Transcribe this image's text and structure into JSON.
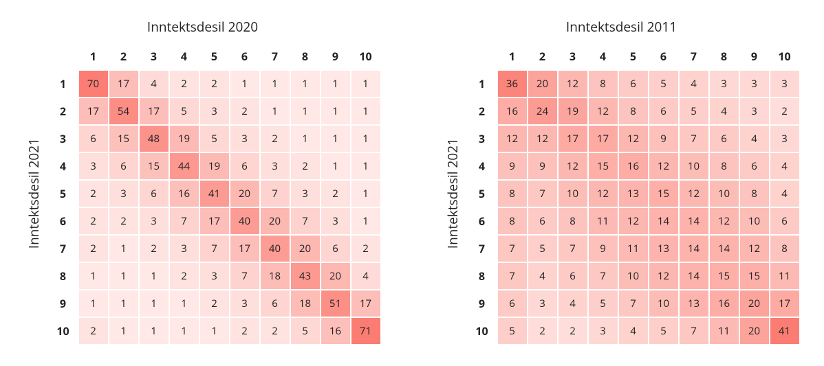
{
  "chart_data": [
    {
      "type": "heatmap",
      "title": "Inntektsdesil 2020",
      "ylabel": "Inntektsdesil 2021",
      "row_labels": [
        "1",
        "2",
        "3",
        "4",
        "5",
        "6",
        "7",
        "8",
        "9",
        "10"
      ],
      "col_labels": [
        "1",
        "2",
        "3",
        "4",
        "5",
        "6",
        "7",
        "8",
        "9",
        "10"
      ],
      "values": [
        [
          70,
          17,
          4,
          2,
          2,
          1,
          1,
          1,
          1,
          1
        ],
        [
          17,
          54,
          17,
          5,
          3,
          2,
          1,
          1,
          1,
          1
        ],
        [
          6,
          15,
          48,
          19,
          5,
          3,
          2,
          1,
          1,
          1
        ],
        [
          3,
          6,
          15,
          44,
          19,
          6,
          3,
          2,
          1,
          1
        ],
        [
          2,
          3,
          6,
          16,
          41,
          20,
          7,
          3,
          2,
          1
        ],
        [
          2,
          2,
          3,
          7,
          17,
          40,
          20,
          7,
          3,
          1
        ],
        [
          2,
          1,
          2,
          3,
          7,
          17,
          40,
          20,
          6,
          2
        ],
        [
          1,
          1,
          1,
          2,
          3,
          7,
          18,
          43,
          20,
          4
        ],
        [
          1,
          1,
          1,
          1,
          2,
          3,
          6,
          18,
          51,
          17
        ],
        [
          2,
          1,
          1,
          1,
          1,
          2,
          2,
          5,
          16,
          71
        ]
      ]
    },
    {
      "type": "heatmap",
      "title": "Inntektsdesil 2011",
      "ylabel": "Inntektsdesil 2021",
      "row_labels": [
        "1",
        "2",
        "3",
        "4",
        "5",
        "6",
        "7",
        "8",
        "9",
        "10"
      ],
      "col_labels": [
        "1",
        "2",
        "3",
        "4",
        "5",
        "6",
        "7",
        "8",
        "9",
        "10"
      ],
      "values": [
        [
          36,
          20,
          12,
          8,
          6,
          5,
          4,
          3,
          3,
          3
        ],
        [
          16,
          24,
          19,
          12,
          8,
          6,
          5,
          4,
          3,
          2
        ],
        [
          12,
          12,
          17,
          17,
          12,
          9,
          7,
          6,
          4,
          3
        ],
        [
          9,
          9,
          12,
          15,
          16,
          12,
          10,
          8,
          6,
          4
        ],
        [
          8,
          7,
          10,
          12,
          13,
          15,
          12,
          10,
          8,
          4
        ],
        [
          8,
          6,
          8,
          11,
          12,
          14,
          14,
          12,
          10,
          6
        ],
        [
          7,
          5,
          7,
          9,
          11,
          13,
          14,
          14,
          12,
          8
        ],
        [
          7,
          4,
          6,
          7,
          10,
          12,
          14,
          15,
          15,
          11
        ],
        [
          6,
          3,
          4,
          5,
          7,
          10,
          13,
          16,
          20,
          17
        ],
        [
          5,
          2,
          2,
          3,
          4,
          5,
          7,
          11,
          20,
          41
        ]
      ]
    }
  ],
  "color_scale": {
    "low": "#fff4f2",
    "high": "#fb7c72"
  }
}
